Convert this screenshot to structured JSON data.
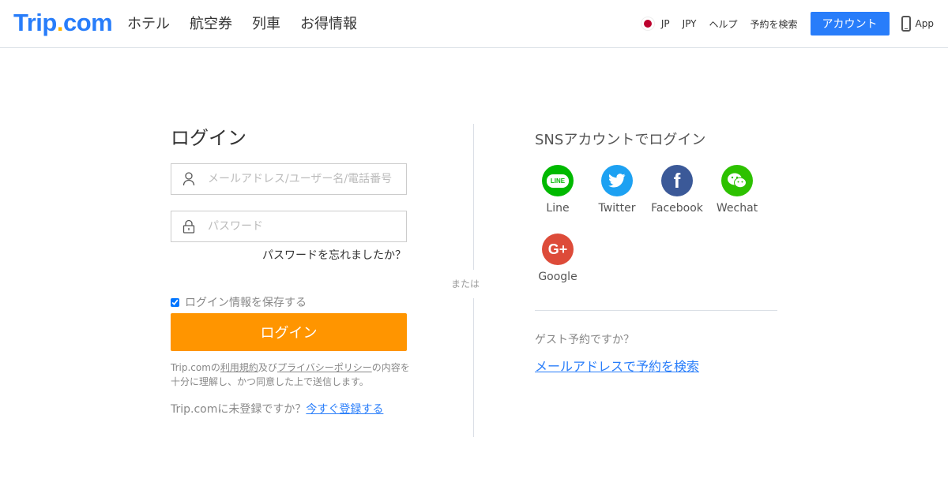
{
  "header": {
    "logo_main": "Trip",
    "logo_dot": ".",
    "logo_tail": "com",
    "nav": [
      "ホテル",
      "航空券",
      "列車",
      "お得情報"
    ],
    "locale": "JP",
    "currency": "JPY",
    "help": "ヘルプ",
    "search_booking": "予約を検索",
    "account_button": "アカウント",
    "app": "App"
  },
  "login": {
    "title": "ログイン",
    "username_placeholder": "メールアドレス/ユーザー名/電話番号",
    "password_placeholder": "パスワード",
    "forgot_password": "パスワードを忘れましたか？",
    "remember_me": "ログイン情報を保存する",
    "remember_checked": true,
    "submit": "ログイン",
    "terms_prefix": "Trip.comの",
    "terms_link": "利用規約",
    "terms_and": "及び",
    "privacy_link": "プライバシーポリシー",
    "terms_suffix": "の内容を十分に理解し、かつ同意した上で送信します。",
    "register_question": "Trip.comに未登録ですか？",
    "register_link": "今すぐ登録する"
  },
  "divider": {
    "or": "または"
  },
  "sns": {
    "title": "SNSアカウントでログイン",
    "providers": [
      {
        "name": "Line",
        "glyph": "LINE",
        "color": "#00b900",
        "icon": "line-icon"
      },
      {
        "name": "Twitter",
        "glyph": "t",
        "color": "#1da1f2",
        "icon": "twitter-icon"
      },
      {
        "name": "Facebook",
        "glyph": "f",
        "color": "#3b5998",
        "icon": "facebook-icon"
      },
      {
        "name": "Wechat",
        "glyph": "w",
        "color": "#2dc100",
        "icon": "wechat-icon"
      },
      {
        "name": "Google",
        "glyph": "G+",
        "color": "#dd4b39",
        "icon": "google-plus-icon"
      }
    ]
  },
  "guest": {
    "question": "ゲスト予約ですか？",
    "link": "メールアドレスで予約を検索"
  },
  "colors": {
    "brand": "#287dfa",
    "accent": "#ff9500",
    "logo_dot": "#ffb400"
  }
}
